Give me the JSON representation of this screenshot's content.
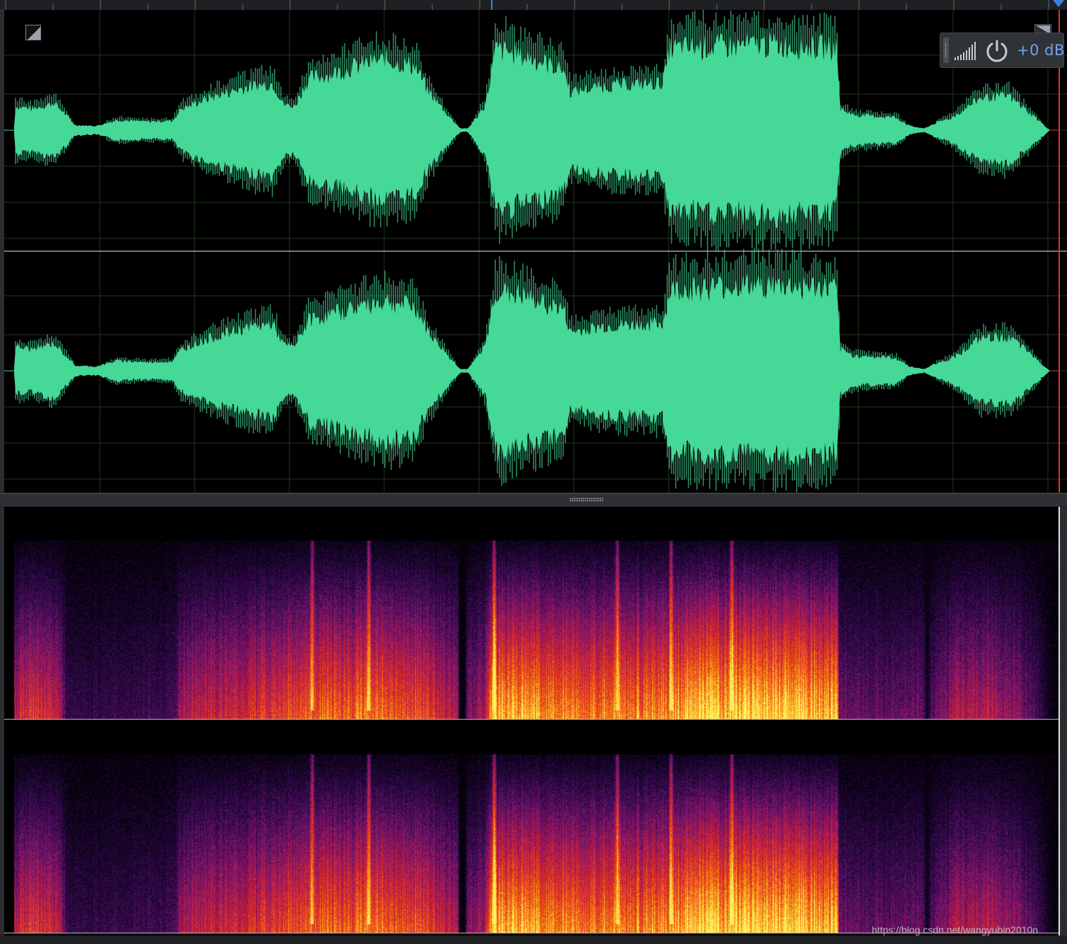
{
  "level": {
    "value": "+0 dB"
  },
  "footer": {
    "watermark": "https://blog.csdn.net/wangyubin2010n"
  },
  "colors": {
    "waveform": "#45d897",
    "grid": "#1f3a1a",
    "playhead": "#d9342b",
    "accent": "#3d7fe0"
  },
  "icons": {
    "zoom_toggle": "diagonal-split-icon",
    "level_meter": "signal-bars-icon",
    "power": "power-icon",
    "grip": "drag-grip-icon"
  }
}
